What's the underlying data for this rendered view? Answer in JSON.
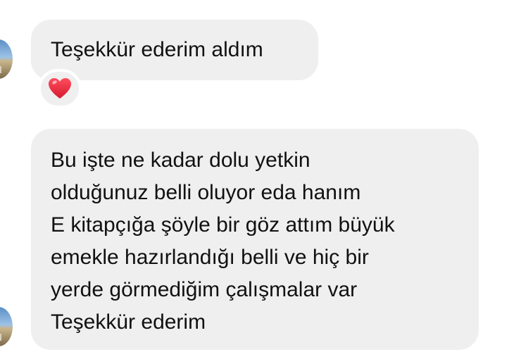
{
  "messages": [
    {
      "lines": [
        "Teşekkür ederim aldım"
      ],
      "reaction": "heart-emoji"
    },
    {
      "lines": [
        "Bu işte ne kadar dolu yetkin",
        "olduğunuz belli oluyor eda hanım",
        "E kitapçığa şöyle bir göz attım büyük",
        "emekle hazırlandığı belli ve hiç bir",
        "yerde görmediğim çalışmalar var",
        "Teşekkür ederim"
      ]
    }
  ],
  "colors": {
    "bubble": "#efefef",
    "text": "#111111",
    "heart": "#e0243a"
  }
}
